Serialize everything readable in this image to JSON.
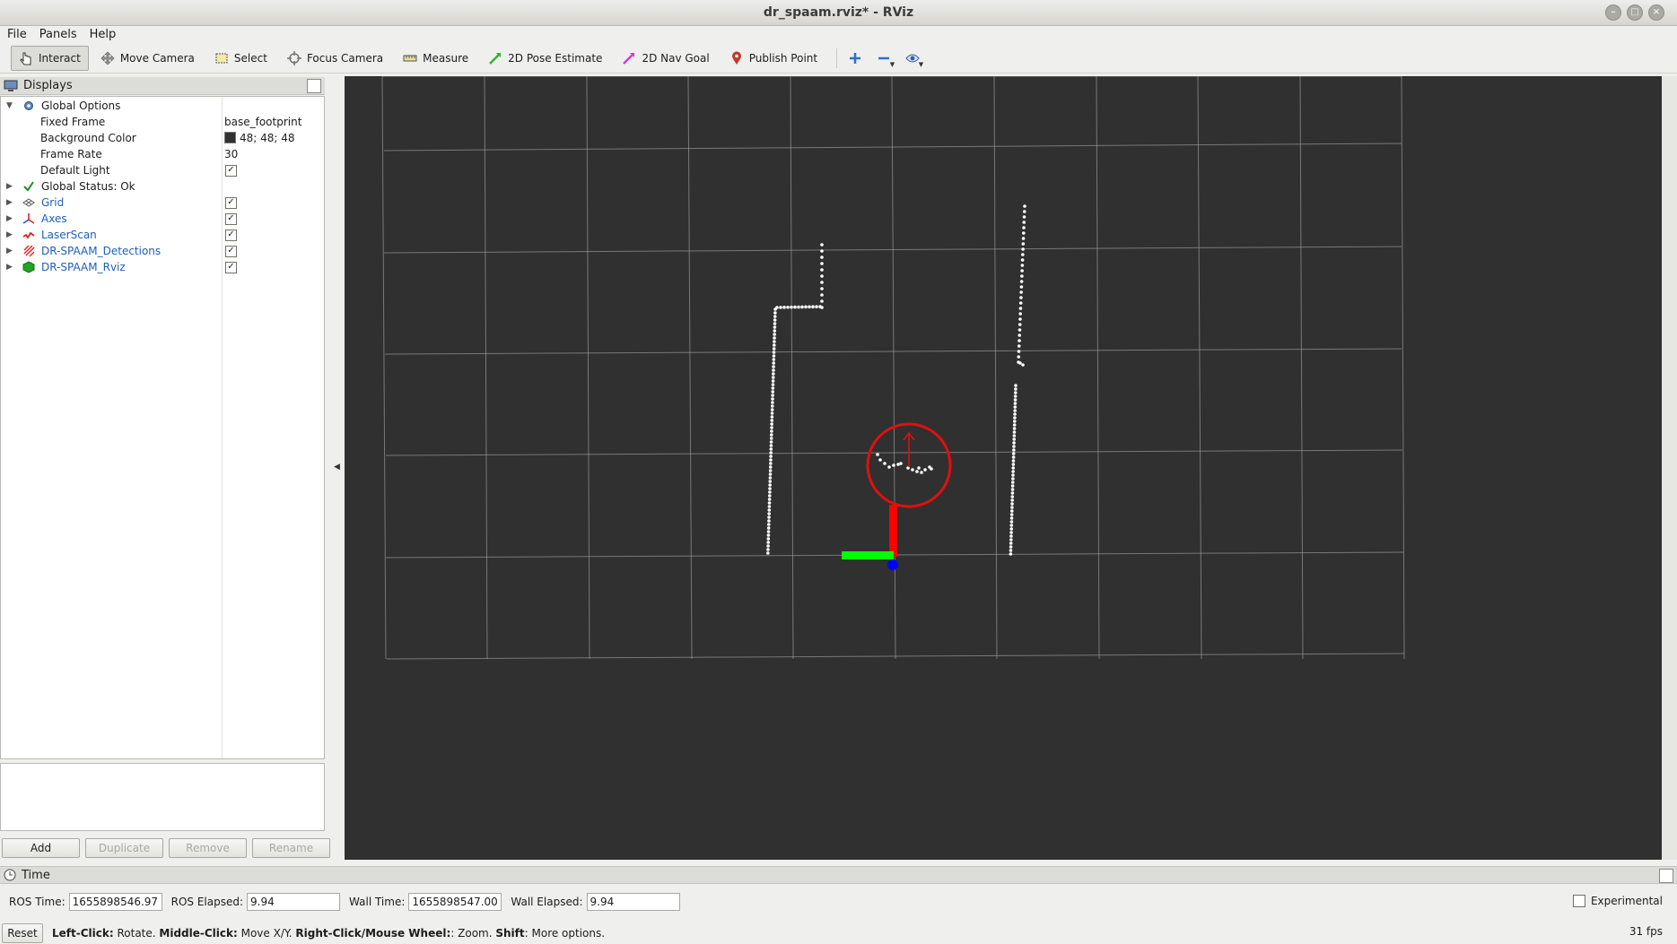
{
  "window": {
    "title": "dr_spaam.rviz* - RViz",
    "buttons": [
      "–",
      "□",
      "×"
    ]
  },
  "menu": [
    "File",
    "Panels",
    "Help"
  ],
  "toolbar": {
    "tools": [
      {
        "label": "Interact",
        "icon": "interact-icon",
        "active": true
      },
      {
        "label": "Move Camera",
        "icon": "move-camera-icon"
      },
      {
        "label": "Select",
        "icon": "select-icon"
      },
      {
        "label": "Focus Camera",
        "icon": "focus-camera-icon"
      },
      {
        "label": "Measure",
        "icon": "measure-icon"
      },
      {
        "label": "2D Pose Estimate",
        "icon": "pose-estimate-icon"
      },
      {
        "label": "2D Nav Goal",
        "icon": "nav-goal-icon"
      },
      {
        "label": "Publish Point",
        "icon": "publish-point-icon"
      }
    ]
  },
  "displays": {
    "title": "Displays",
    "global_options": {
      "label": "Global Options",
      "fixed_frame_label": "Fixed Frame",
      "fixed_frame_value": "base_footprint",
      "bg_color_label": "Background Color",
      "bg_color_value": "48; 48; 48",
      "frame_rate_label": "Frame Rate",
      "frame_rate_value": "30",
      "default_light_label": "Default Light"
    },
    "global_status": "Global Status: Ok",
    "items": [
      {
        "label": "Grid",
        "icon": "grid-icon",
        "checked": true
      },
      {
        "label": "Axes",
        "icon": "axes-icon",
        "checked": true
      },
      {
        "label": "LaserScan",
        "icon": "laserscan-icon",
        "checked": true
      },
      {
        "label": "DR-SPAAM_Detections",
        "icon": "detections-icon",
        "checked": true
      },
      {
        "label": "DR-SPAAM_Rviz",
        "icon": "rviz-marker-icon",
        "checked": true
      }
    ],
    "buttons": {
      "add": "Add",
      "duplicate": "Duplicate",
      "remove": "Remove",
      "rename": "Rename"
    }
  },
  "time": {
    "title": "Time",
    "ros_time_label": "ROS Time:",
    "ros_time": "1655898546.97",
    "ros_elapsed_label": "ROS Elapsed:",
    "ros_elapsed": "9.94",
    "wall_time_label": "Wall Time:",
    "wall_time": "1655898547.00",
    "wall_elapsed_label": "Wall Elapsed:",
    "wall_elapsed": "9.94",
    "experimental_label": "Experimental"
  },
  "status": {
    "reset": "Reset",
    "hint_b1": "Left-Click:",
    "hint_t1": " Rotate. ",
    "hint_b2": "Middle-Click:",
    "hint_t2": " Move X/Y. ",
    "hint_b3": "Right-Click/Mouse Wheel:",
    "hint_t3": ": Zoom. ",
    "hint_b4": "Shift",
    "hint_t4": ": More options.",
    "fps": "31 fps"
  },
  "scene": {
    "background": "#303030",
    "grid_color": "#a0a0a0",
    "laser_color": "#ffffff",
    "detection_color": "#e01010",
    "axis_x_color": "#ff0000",
    "axis_y_color": "#00ff00",
    "axis_z_color": "#0000ff"
  }
}
